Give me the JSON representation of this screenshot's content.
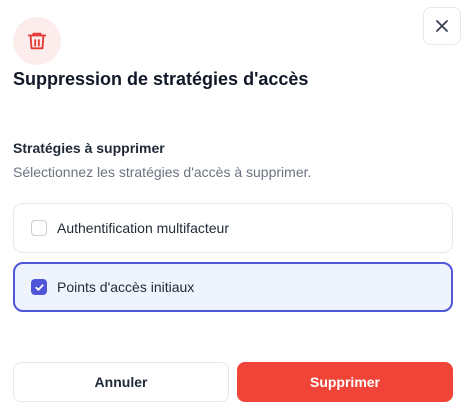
{
  "dialog": {
    "title": "Suppression de stratégies d'accès",
    "icon": "trash-icon",
    "close_icon": "close-icon"
  },
  "section": {
    "title": "Stratégies à supprimer",
    "description": "Sélectionnez les stratégies d'accès à supprimer."
  },
  "options": [
    {
      "label": "Authentification multifacteur",
      "checked": false
    },
    {
      "label": "Points d'accès initiaux",
      "checked": true
    }
  ],
  "buttons": {
    "cancel_label": "Annuler",
    "delete_label": "Supprimer"
  },
  "colors": {
    "accent": "#4f56d8",
    "danger": "#f04438",
    "danger_light": "#fdecec",
    "selected_bg": "#eef3fd"
  }
}
